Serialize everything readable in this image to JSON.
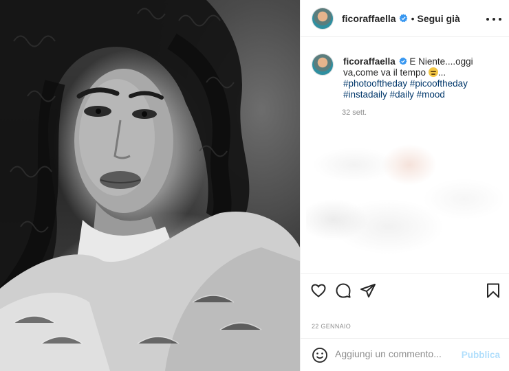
{
  "post": {
    "username": "ficoraffaella",
    "dot": "•",
    "follow_label": "Segui già"
  },
  "caption": {
    "username": "ficoraffaella",
    "text_a": "E Niente....oggi va,come va il tempo",
    "ellipsis": "...",
    "hashtags": [
      "#photooftheday",
      "#picooftheday",
      "#instadaily",
      "#daily",
      "#mood"
    ],
    "time": "32 sett."
  },
  "meta": {
    "date": "22 GENNAIO"
  },
  "comment_box": {
    "placeholder": "Aggiungi un commento...",
    "publish_label": "Pubblica"
  },
  "icons": {
    "verified": "verified-badge-icon",
    "more": "more-options-icon",
    "like": "heart-icon",
    "comment": "comment-bubble-icon",
    "share": "paper-plane-icon",
    "save": "bookmark-icon",
    "emoji": "smiley-icon"
  },
  "colors": {
    "verified": "#3897f0",
    "hashtag": "#00376b",
    "publish_disabled": "#b2dffc",
    "muted": "#8e8e8e"
  }
}
